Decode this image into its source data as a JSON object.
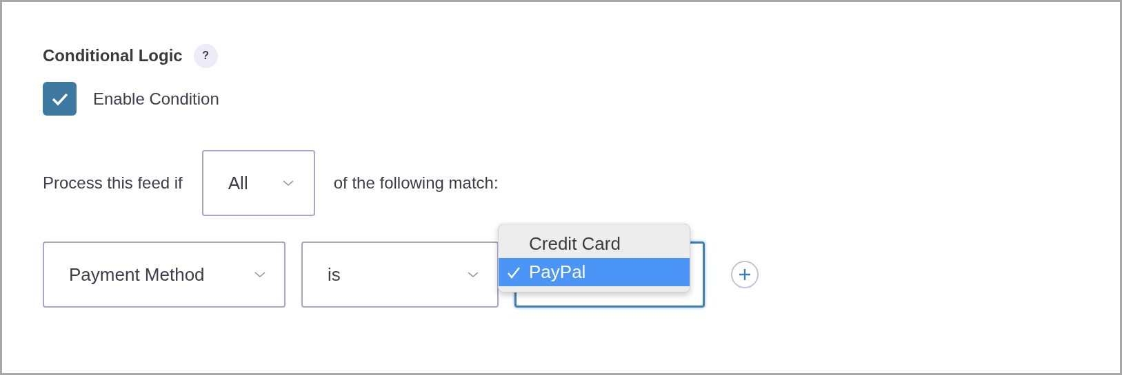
{
  "section": {
    "title": "Conditional Logic",
    "help": "?"
  },
  "enable": {
    "label": "Enable Condition",
    "checked": true
  },
  "match": {
    "prefix": "Process this feed if",
    "value": "All",
    "suffix": "of the following match:"
  },
  "rule": {
    "field": "Payment Method",
    "operator": "is",
    "value_focused": true,
    "menu": [
      {
        "label": "Credit Card",
        "selected": false
      },
      {
        "label": "PayPal",
        "selected": true
      }
    ]
  }
}
